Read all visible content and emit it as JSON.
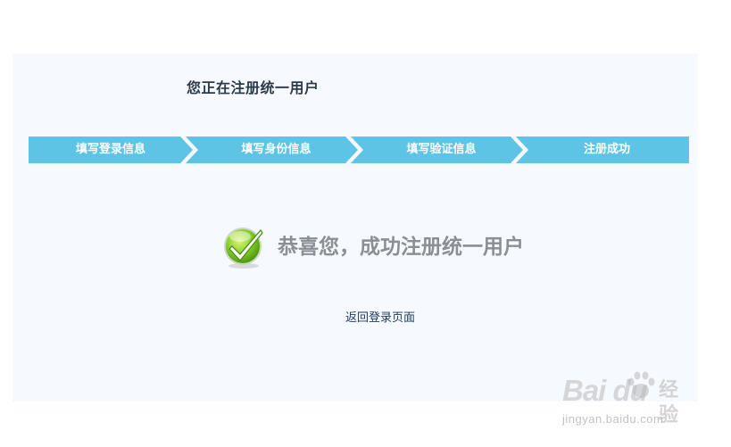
{
  "header": {
    "title": "您正在注册统一用户"
  },
  "steps": [
    {
      "label": "填写登录信息"
    },
    {
      "label": "填写身份信息"
    },
    {
      "label": "填写验证信息"
    },
    {
      "label": "注册成功"
    }
  ],
  "result": {
    "icon": "checkmark-icon",
    "message": "恭喜您，成功注册统一用户"
  },
  "actions": {
    "back_to_login": "返回登录页面"
  },
  "watermark": {
    "logo": "Bai du",
    "brand": "经验",
    "url": "jingyan.baidu.com"
  },
  "colors": {
    "step_fill": "#5ec4e6",
    "panel_background": "#f6f9fe",
    "success_green": "#6cbf1e",
    "message_gray": "#8a8f96"
  }
}
